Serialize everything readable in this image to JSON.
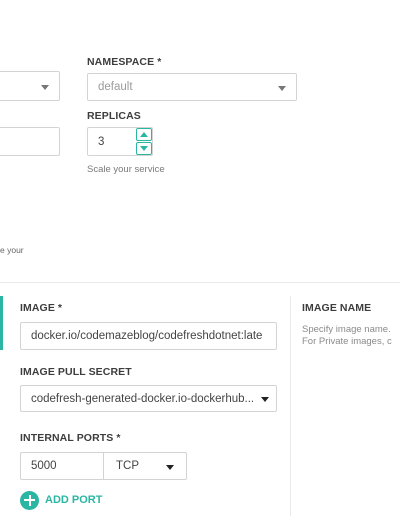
{
  "top": {
    "namespace_label": "NAMESPACE *",
    "namespace_value": "default",
    "replicas_label": "REPLICAS",
    "replicas_value": "3",
    "replicas_hint": "Scale your service",
    "cut_off_text": "e your"
  },
  "container": {
    "image_label": "IMAGE *",
    "image_value": "docker.io/codemazeblog/codefreshdotnet:late",
    "pull_secret_label": "IMAGE PULL SECRET",
    "pull_secret_value": "codefresh-generated-docker.io-dockerhub...",
    "ports_label": "INTERNAL PORTS *",
    "port_value": "5000",
    "protocol_value": "TCP",
    "add_port_label": "ADD PORT"
  },
  "help": {
    "title": "IMAGE NAME",
    "line1": "Specify image name.",
    "line2": "For Private images, c"
  },
  "colors": {
    "accent": "#2bb6a3",
    "border": "#d3d3d3"
  },
  "icons": [
    "chevron-down-icon",
    "chevron-up-icon",
    "plus-circle-icon"
  ]
}
